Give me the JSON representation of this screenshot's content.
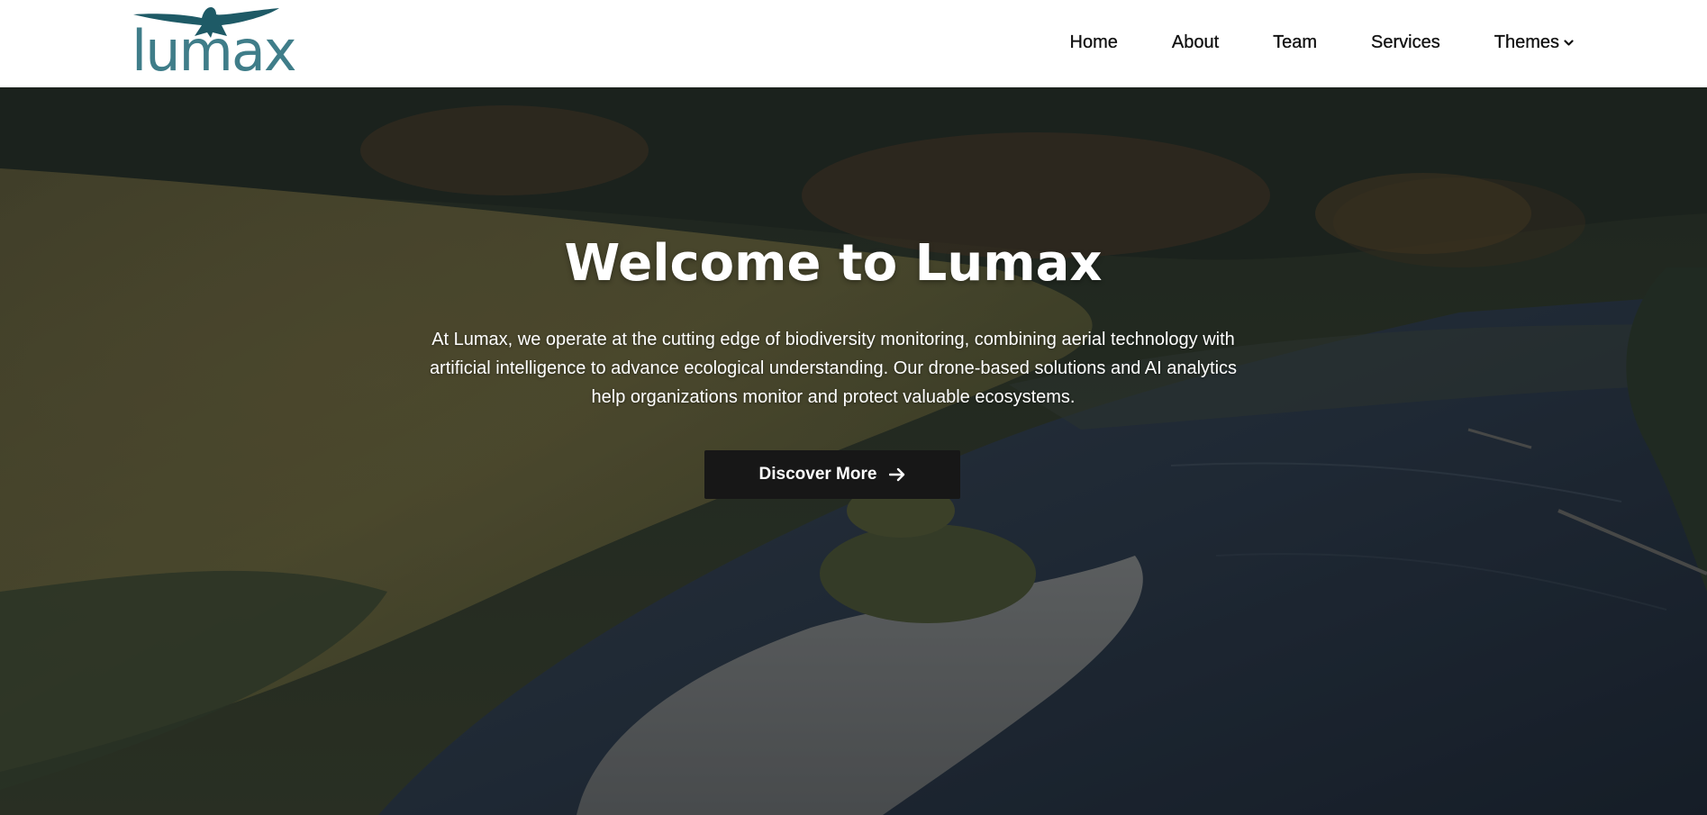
{
  "brand": {
    "name": "lumax",
    "logo_icon": "hawk-silhouette-icon",
    "logo_color": "#3f7d89",
    "bird_color": "#1e5a66"
  },
  "nav": {
    "items": [
      {
        "label": "Home"
      },
      {
        "label": "About"
      },
      {
        "label": "Team"
      },
      {
        "label": "Services"
      },
      {
        "label": "Themes",
        "icon": "chevron-down-icon"
      }
    ]
  },
  "hero": {
    "title": "Welcome to Lumax",
    "text": "At Lumax, we operate at the cutting edge of biodiversity monitoring, combining aerial technology with artificial intelligence to advance ecological understanding. Our drone-based solutions and AI analytics help organizations monitor and protect valuable ecosystems.",
    "cta_label": "Discover More",
    "cta_icon": "arrow-right-icon",
    "cta_background": "#171717"
  }
}
